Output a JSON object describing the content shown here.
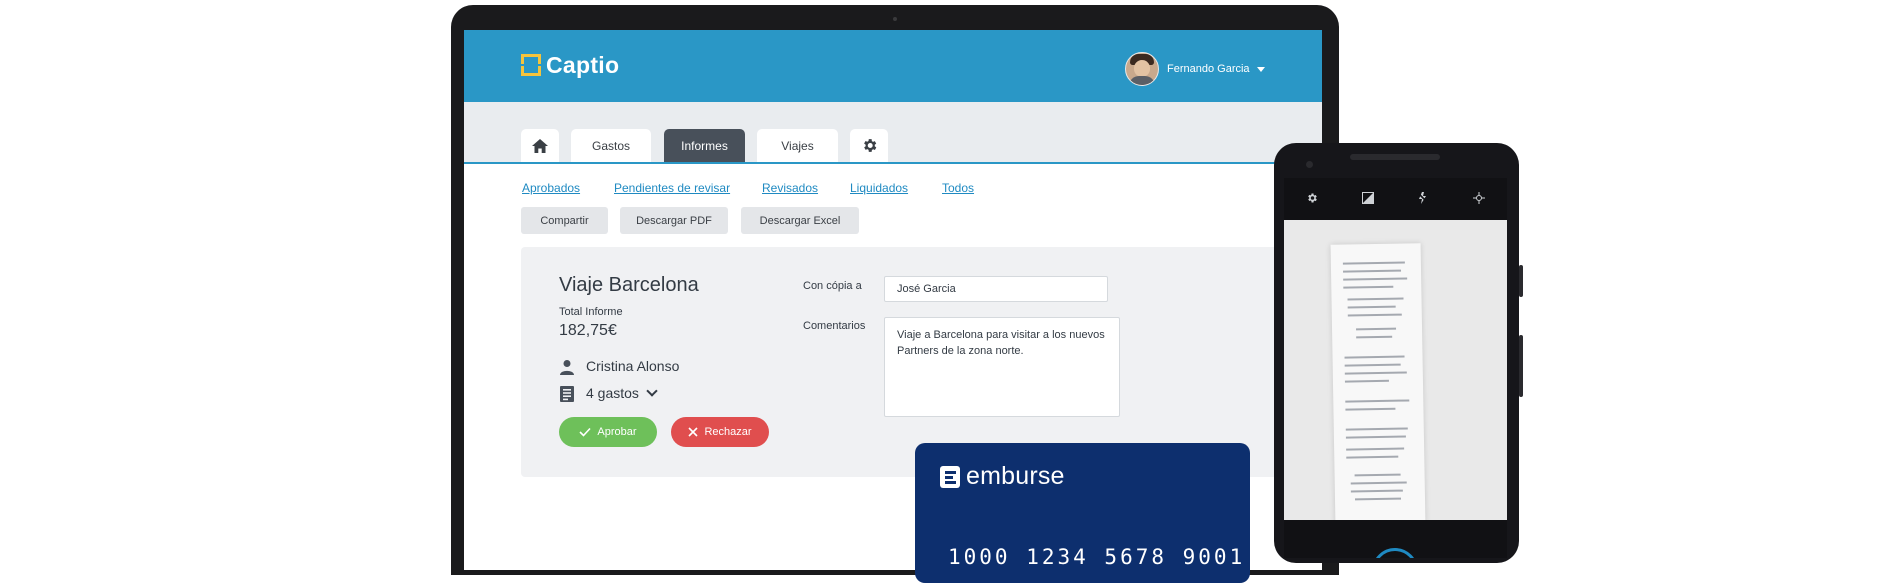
{
  "app": {
    "logo_text": "Captio",
    "user": {
      "name": "Fernando Garcia"
    }
  },
  "tabs": [
    {
      "label": ""
    },
    {
      "label": "Gastos"
    },
    {
      "label": "Informes"
    },
    {
      "label": "Viajes"
    },
    {
      "label": ""
    }
  ],
  "subnav": [
    "Aprobados",
    "Pendientes de revisar",
    "Revisados",
    "Liquidados",
    "Todos"
  ],
  "actions": [
    "Compartir",
    "Descargar PDF",
    "Descargar Excel"
  ],
  "report": {
    "title": "Viaje Barcelona",
    "total_label": "Total Informe",
    "total_value": "182,75€",
    "owner": "Cristina Alonso",
    "expenses": "4 gastos",
    "cc_label": "Con cópia a",
    "cc_value": "José Garcia",
    "comments_label": "Comentarios",
    "comments_value": "Viaje a Barcelona para visitar a los nuevos Partners de la zona norte.",
    "approve": "Aprobar",
    "reject": "Rechazar"
  },
  "card": {
    "brand": "emburse",
    "number": "1000 1234 5678 9001"
  },
  "colors": {
    "header": "#2a97c6",
    "active_tab": "#48505a",
    "link": "#1f8ac2",
    "approve": "#6ec05a",
    "reject": "#e04e4e",
    "card": "#0d2f6e",
    "logo_accent": "#f5c43c"
  },
  "icons": {
    "home": "home-icon",
    "settings": "gear-icon",
    "owner": "person-icon",
    "expenses": "receipt-icon",
    "approve": "check-icon",
    "reject": "close-icon",
    "phone_bar": [
      "settings-icon",
      "exposure-icon",
      "flash-off-icon",
      "focus-icon"
    ]
  }
}
